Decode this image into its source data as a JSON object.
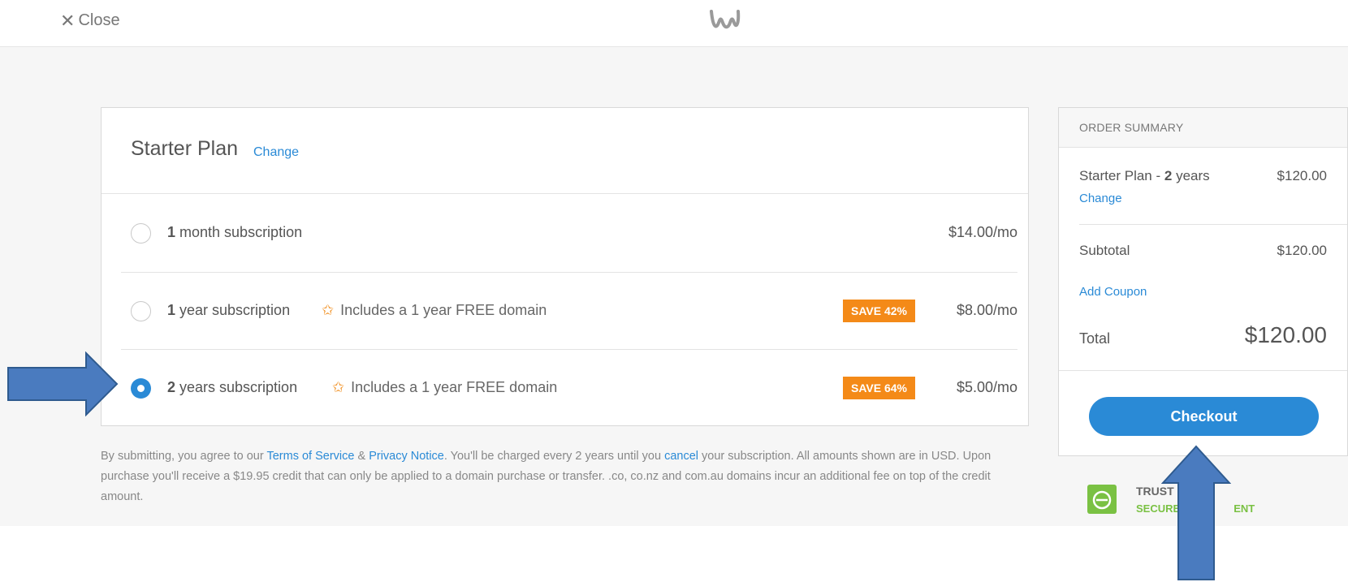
{
  "header": {
    "close_label": "Close",
    "logo_icon": "weebly-w-logo-icon"
  },
  "plan": {
    "title": "Starter Plan",
    "change_label": "Change",
    "options": [
      {
        "term_bold": "1",
        "term_rest": " month subscription",
        "perk": "",
        "badge": "",
        "price": "$14.00/mo",
        "selected": false
      },
      {
        "term_bold": "1",
        "term_rest": " year subscription",
        "perk": "Includes a 1 year FREE domain",
        "badge": "SAVE 42%",
        "price": "$8.00/mo",
        "selected": false
      },
      {
        "term_bold": "2",
        "term_rest": " years subscription",
        "perk": "Includes a 1 year FREE domain",
        "badge": "SAVE 64%",
        "price": "$5.00/mo",
        "selected": true
      }
    ]
  },
  "legal": {
    "p1": "By submitting, you agree to our ",
    "terms": "Terms of Service",
    "amp": " & ",
    "privacy": "Privacy Notice",
    "p2": ". You'll be charged every 2 years until you ",
    "cancel": "cancel",
    "p3": " your subscription. All amounts shown are in USD. Upon purchase you'll receive a $19.95 credit that can only be applied to a domain purchase or transfer. .co, co.nz and com.au domains incur an additional fee on top of the credit amount."
  },
  "summary": {
    "heading": "ORDER SUMMARY",
    "item_name": "Starter Plan - ",
    "item_term_bold": "2",
    "item_term_rest": " years",
    "item_price": "$120.00",
    "item_change": "Change",
    "subtotal_label": "Subtotal",
    "subtotal_value": "$120.00",
    "add_coupon": "Add Coupon",
    "total_label": "Total",
    "total_value": "$120.00",
    "checkout_label": "Checkout"
  },
  "trust": {
    "line1": "TRUST",
    "line2": "SECURE",
    "line2_end": "ENT"
  },
  "colors": {
    "accent": "#2a8ad6",
    "badge": "#f48a18",
    "arrow": "#4a7bbf"
  }
}
